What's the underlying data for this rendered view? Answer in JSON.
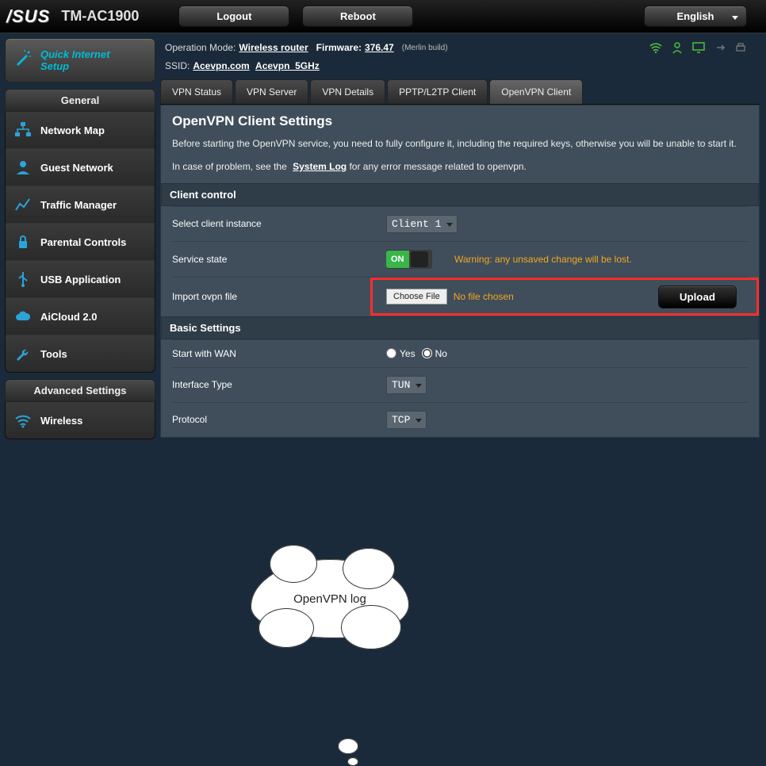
{
  "top": {
    "brand": "/SUS",
    "model": "TM-AC1900",
    "logout": "Logout",
    "reboot": "Reboot",
    "lang": "English"
  },
  "qis": {
    "line1": "Quick Internet",
    "line2": "Setup"
  },
  "section_general": "General",
  "nav_general": [
    "Network Map",
    "Guest Network",
    "Traffic Manager",
    "Parental Controls",
    "USB Application",
    "AiCloud 2.0",
    "Tools"
  ],
  "section_advanced": "Advanced Settings",
  "nav_advanced": [
    "Wireless"
  ],
  "info": {
    "op_mode_label": "Operation Mode:",
    "op_mode_value": "Wireless router",
    "fw_label": "Firmware:",
    "fw_value": "376.47",
    "build": "(Merlin build)",
    "ssid_label": "SSID:",
    "ssid1": "Acevpn.com",
    "ssid2": "Acevpn_5GHz"
  },
  "tabs": [
    "VPN Status",
    "VPN Server",
    "VPN Details",
    "PPTP/L2TP Client",
    "OpenVPN Client"
  ],
  "panel": {
    "title": "OpenVPN Client Settings",
    "desc1a": "Before starting the OpenVPN service, you need to fully configure it, including the required keys, otherwise you will be unable to start it.",
    "desc2a": "In case of problem, see the ",
    "desc2link": "System Log",
    "desc2b": " for any error message related to openvpn.",
    "hdr_client": "Client control",
    "sel_instance_lbl": "Select client instance",
    "sel_instance_val": "Client 1",
    "service_state_lbl": "Service state",
    "toggle_on": "ON",
    "warn": "Warning: any unsaved change will be lost.",
    "import_lbl": "Import ovpn file",
    "choose_file": "Choose File",
    "no_file": "No file chosen",
    "upload": "Upload",
    "hdr_basic": "Basic Settings",
    "start_wan_lbl": "Start with WAN",
    "yes": "Yes",
    "no": "No",
    "iface_lbl": "Interface Type",
    "iface_val": "TUN",
    "proto_lbl": "Protocol",
    "proto_val": "TCP"
  },
  "callout": "OpenVPN log"
}
